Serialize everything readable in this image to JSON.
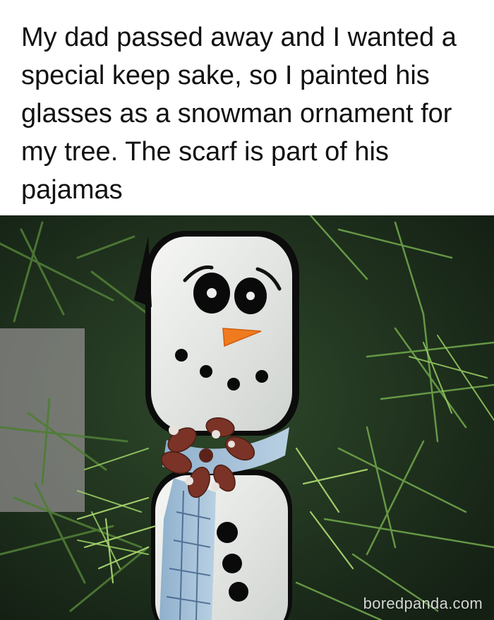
{
  "post": {
    "caption": "My dad passed away and I wanted a special keep sake, so I painted his glasses as a snowman ornament for my tree. The scarf is part of his pajamas"
  },
  "photo": {
    "subject": "snowman-ornament",
    "watermark": "boredpanda.com"
  },
  "colors": {
    "background": "#ffffff",
    "caption_text": "#111111",
    "tree_green": "#3f6b2e",
    "snowman_white": "#eef0ee",
    "lens_frame": "#0c0c0c",
    "carrot_nose": "#f07a1e",
    "pinecone": "#7a3326",
    "scarf_blue": "#a8c4dc"
  }
}
